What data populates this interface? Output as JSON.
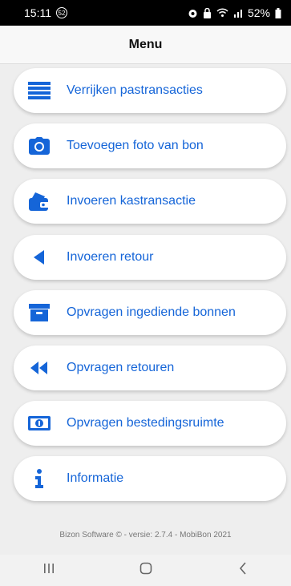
{
  "status_bar": {
    "time": "15:11",
    "notification_badge": "52",
    "battery": "52%"
  },
  "header": {
    "title": "Menu"
  },
  "menu": {
    "items": [
      {
        "label": "Verrijken pastransacties",
        "icon": "list-icon"
      },
      {
        "label": "Toevoegen foto van bon",
        "icon": "camera-icon"
      },
      {
        "label": "Invoeren kastransactie",
        "icon": "wallet-icon"
      },
      {
        "label": "Invoeren retour",
        "icon": "triangle-left-icon"
      },
      {
        "label": "Opvragen ingediende bonnen",
        "icon": "archive-box-icon"
      },
      {
        "label": "Opvragen retouren",
        "icon": "double-left-icon"
      },
      {
        "label": "Opvragen bestedingsruimte",
        "icon": "money-bill-icon"
      },
      {
        "label": "Informatie",
        "icon": "info-icon"
      }
    ]
  },
  "footer": {
    "text": "Bizon Software © - versie: 2.7.4 - MobiBon 2021"
  },
  "colors": {
    "accent": "#1565d8",
    "background": "#eeeeee",
    "card": "#ffffff"
  }
}
